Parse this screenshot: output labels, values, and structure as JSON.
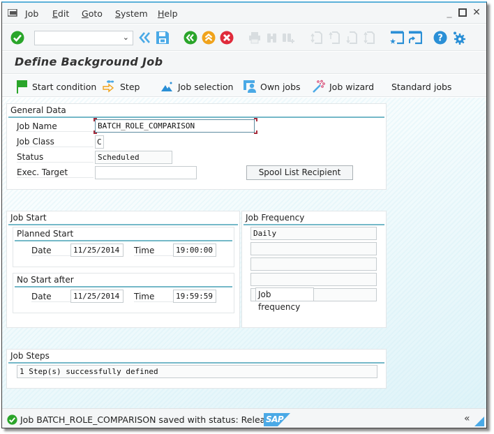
{
  "menu": {
    "items": [
      {
        "label": "Job"
      },
      {
        "label": "Edit"
      },
      {
        "label": "Goto"
      },
      {
        "label": "System"
      },
      {
        "label": "Help"
      }
    ]
  },
  "window_controls": {
    "minimize": "_",
    "maximize": "□",
    "close": "✕"
  },
  "toolbar": {
    "command_field_value": "",
    "icons": [
      "enter-icon",
      "back-arrows-icon",
      "save-icon",
      "back-icon",
      "exit-icon",
      "cancel-icon",
      "print-icon",
      "find-icon",
      "find-next-icon",
      "first-page-icon",
      "previous-page-icon",
      "next-page-icon",
      "last-page-icon",
      "create-session-icon",
      "create-shortcut-icon",
      "help-icon",
      "settings-icon"
    ]
  },
  "page": {
    "title": "Define Background Job"
  },
  "app_toolbar": {
    "buttons": [
      {
        "label": "Start condition",
        "icon": "flag-icon"
      },
      {
        "label": "Step",
        "icon": "step-icon"
      },
      {
        "label": "Job selection",
        "icon": "job-selection-icon"
      },
      {
        "label": "Own jobs",
        "icon": "own-jobs-icon"
      },
      {
        "label": "Job wizard",
        "icon": "wizard-icon"
      },
      {
        "label": "Standard jobs",
        "icon": ""
      }
    ]
  },
  "general_data": {
    "title": "General Data",
    "job_name_label": "Job Name",
    "job_name_value": "BATCH_ROLE_COMPARISON",
    "job_class_label": "Job Class",
    "job_class_value": "C",
    "status_label": "Status",
    "status_value": "Scheduled",
    "exec_target_label": "Exec. Target",
    "exec_target_value": "",
    "spool_button": "Spool List Recipient"
  },
  "job_start": {
    "title": "Job Start",
    "planned_start": {
      "title": "Planned Start",
      "date_label": "Date",
      "date_value": "11/25/2014",
      "time_label": "Time",
      "time_value": "19:00:00"
    },
    "no_start_after": {
      "title": "No Start after",
      "date_label": "Date",
      "date_value": "11/25/2014",
      "time_label": "Time",
      "time_value": "19:59:59"
    }
  },
  "job_frequency": {
    "title": "Job Frequency",
    "lines": [
      "Daily",
      "",
      "",
      ""
    ],
    "button": "Job frequency"
  },
  "job_steps": {
    "title": "Job Steps",
    "value": "1 Step(s) successfully defined"
  },
  "status_bar": {
    "message": "Job BATCH_ROLE_COMPARISON saved with status: Released",
    "logo": "SAP",
    "collapse": "«"
  },
  "colors": {
    "accent_line": "#74b8c8",
    "sap_blue": "#4aa9e6",
    "success_green": "#2aa52a",
    "error_red": "#e02b3b",
    "warning_orange": "#f0a31c"
  }
}
